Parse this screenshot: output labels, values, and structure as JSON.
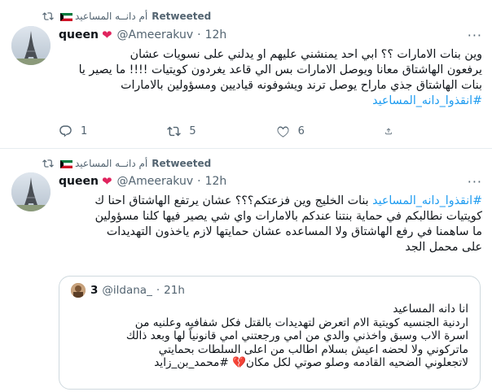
{
  "tweets": [
    {
      "retweeted_by": "أم دانــه المساعيد",
      "retweeted_label": "Retweeted",
      "name": "queen",
      "handle": "@Ameerakuv",
      "time": "12h",
      "lines": [
        "وين بنات الامارات ؟؟ ابي احد يمنشني عليهم او يدلني على نسويات عشان",
        "يرفعون الهاشتاق معانا ويوصل الامارات بس الي قاعد يغردون كويتيات !!!! ما يصير يا",
        "بنات الهاشتاق جذي ماراح يوصل ترند ويشوفونه قياديين ومسؤولين بالامارات",
        "#انقذوا_دانه_المساعيد"
      ],
      "reply_count": "1",
      "retweet_count": "5",
      "like_count": "6"
    },
    {
      "retweeted_by": "أم دانــه المساعيد",
      "retweeted_label": "Retweeted",
      "name": "queen",
      "handle": "@Ameerakuv",
      "time": "12h",
      "line1_hashtag": "#انقذوا_دانه_المساعيد",
      "line1_text": " بنات الخليج وين فزعتكم؟؟؟ عشان يرتفع الهاشتاق احنا ك",
      "lines": [
        "كويتيات نطالبكم في حماية بنتنا عندكم بالامارات واي شي يصير فيها كلنا مسؤولين",
        "ما ساهمنا في رفع الهاشتاق ولا المساعده عشان حمايتها لازم ياخذون التهديدات",
        "على محمل الجد"
      ],
      "quote": {
        "name": "3",
        "handle": "@ildana_",
        "time": "21h",
        "lines": [
          "انا دانه المساعيد",
          "اردنية الجنسيه كويتية الام اتعرض لتهديدات بالقتل فكل شفافيه وعلنيه من",
          "اسرة الاب وسبق واخذني والدي من امي ورجعتني امي قانونياً لها وبعد ذالك",
          "ماتركوني ولا لحضه اعيش بسلام اطالب من اعلى السلطات بحمايتي",
          "لاتجعلوني الضحيه القادمه وصلو صوتي لكل مكان💔 #محمد_بن_زايد"
        ]
      }
    }
  ],
  "colors": {
    "accent": "#1d9bf0",
    "heart": "#e0245e",
    "muted": "#536471"
  },
  "icons": [
    "retweet-icon",
    "kuwait-flag-icon",
    "heart-emoji-icon",
    "reply-icon",
    "like-icon",
    "more-icon"
  ]
}
